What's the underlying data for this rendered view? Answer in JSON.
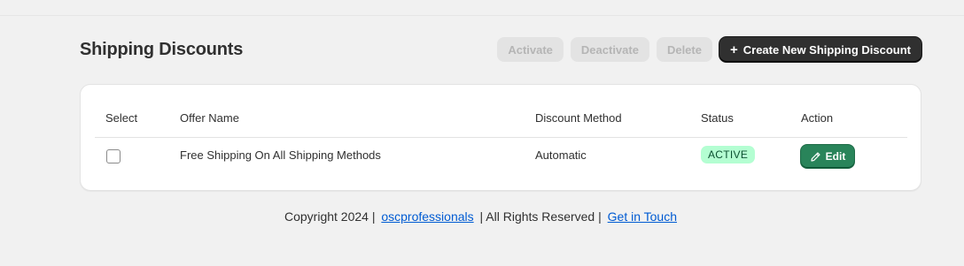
{
  "page": {
    "title": "Shipping Discounts"
  },
  "toolbar": {
    "activate_label": "Activate",
    "deactivate_label": "Deactivate",
    "delete_label": "Delete",
    "create_label": "Create New Shipping Discount",
    "create_icon": "plus-icon"
  },
  "table": {
    "headers": {
      "select": "Select",
      "offer_name": "Offer Name",
      "discount_method": "Discount Method",
      "status": "Status",
      "action": "Action"
    },
    "rows": [
      {
        "selected": false,
        "offer_name": "Free Shipping On All Shipping Methods",
        "discount_method": "Automatic",
        "status": "ACTIVE",
        "action_label": "Edit",
        "action_icon": "pencil-icon"
      }
    ]
  },
  "footer": {
    "copyright": "Copyright 2024 |",
    "company_link": "oscprofessionals",
    "rights": "| All Rights Reserved |",
    "contact_link": "Get in Touch"
  },
  "colors": {
    "background": "#f1f1f1",
    "primary_button": "#303030",
    "edit_button": "#29845a",
    "active_badge_bg": "#b4fed2",
    "active_badge_text": "#0c5132",
    "link": "#005bd3"
  }
}
